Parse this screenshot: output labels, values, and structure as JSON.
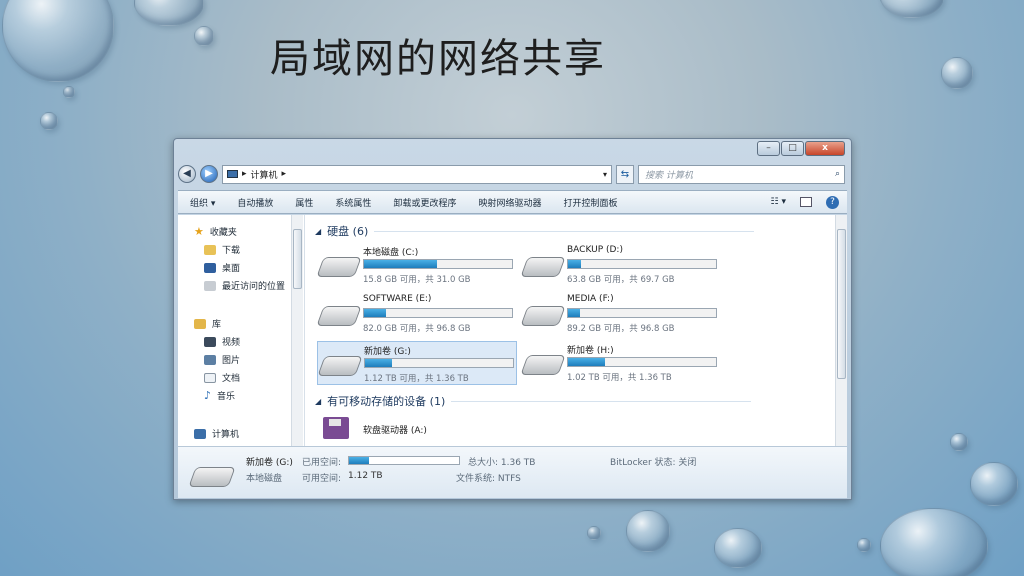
{
  "slide": {
    "title": "局域网的网络共享"
  },
  "window": {
    "buttons": {
      "minimize": "–",
      "maximize": "□",
      "close": "x"
    },
    "address": {
      "path_root": "计算机",
      "separator": "▸",
      "dropdown": "▾"
    },
    "search": {
      "placeholder": "搜索 计算机",
      "icon": "⌕"
    },
    "toolbar": {
      "items": [
        "组织 ▾",
        "自动播放",
        "属性",
        "系统属性",
        "卸载或更改程序",
        "映射网络驱动器",
        "打开控制面板"
      ],
      "view": "☷ ▾",
      "help": "?"
    },
    "nav": {
      "favorites": "收藏夹",
      "downloads": "下载",
      "desktop": "桌面",
      "recent": "最近访问的位置",
      "libraries": "库",
      "videos": "视频",
      "pictures": "图片",
      "documents": "文档",
      "music": "音乐",
      "computer": "计算机"
    },
    "groups": {
      "hdd": "硬盘 (6)",
      "removable": "有可移动存储的设备 (1)"
    },
    "drives": [
      {
        "name": "本地磁盘 (C:)",
        "info": "15.8 GB 可用，共 31.0 GB",
        "used": 0.49
      },
      {
        "name": "BACKUP (D:)",
        "info": "63.8 GB 可用，共 69.7 GB",
        "used": 0.09
      },
      {
        "name": "SOFTWARE (E:)",
        "info": "82.0 GB 可用，共 96.8 GB",
        "used": 0.15
      },
      {
        "name": "MEDIA (F:)",
        "info": "89.2 GB 可用，共 96.8 GB",
        "used": 0.08
      },
      {
        "name": "新加卷 (G:)",
        "info": "1.12 TB 可用，共 1.36 TB",
        "used": 0.18
      },
      {
        "name": "新加卷 (H:)",
        "info": "1.02 TB 可用，共 1.36 TB",
        "used": 0.25
      }
    ],
    "floppy": {
      "name": "软盘驱动器 (A:)"
    },
    "details": {
      "name": "新加卷 (G:)",
      "type": "本地磁盘",
      "used_label": "已用空间:",
      "free_label": "可用空间:",
      "free_value": "1.12 TB",
      "total_label": "总大小: 1.36 TB",
      "fs_label": "文件系统: NTFS",
      "bitlocker": "BitLocker 状态: 关闭",
      "used": 0.18
    },
    "colors": {
      "bar_fill": "#1e7dbc",
      "selection": "#dce9f7"
    }
  }
}
